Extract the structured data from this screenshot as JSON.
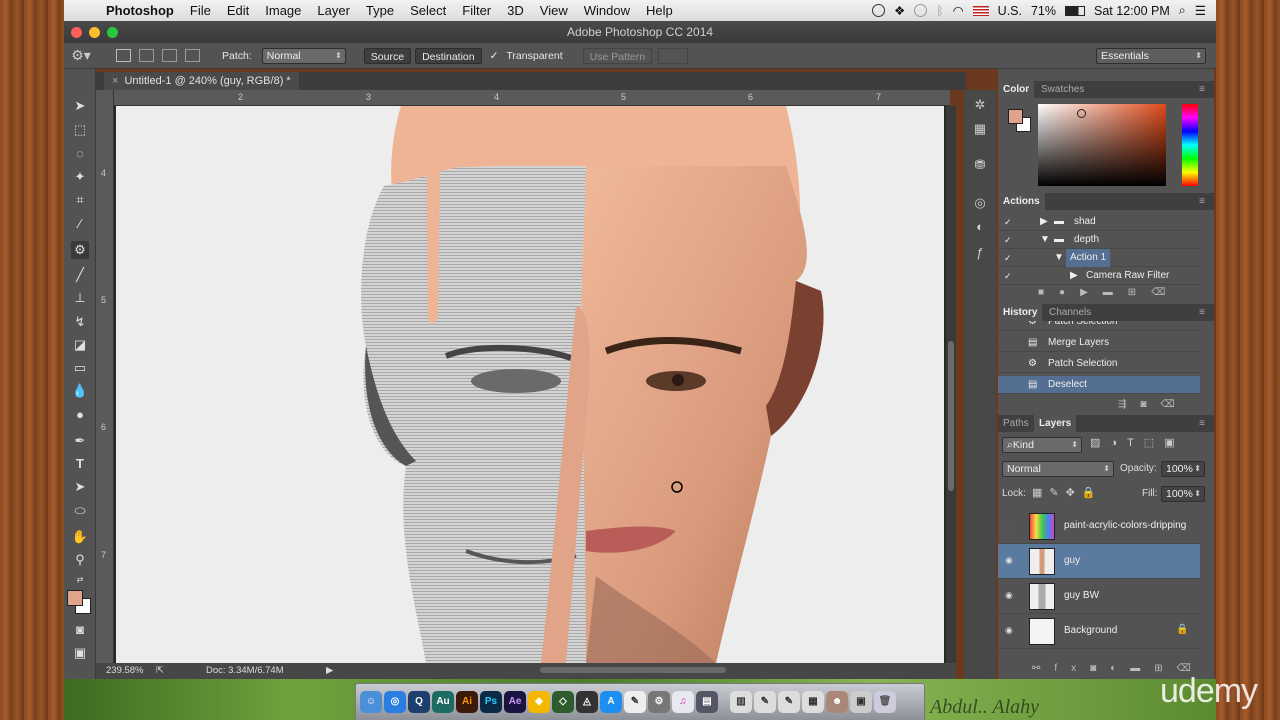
{
  "mac_menu": {
    "app": "Photoshop",
    "items": [
      "File",
      "Edit",
      "Image",
      "Layer",
      "Type",
      "Select",
      "Filter",
      "3D",
      "View",
      "Window",
      "Help"
    ],
    "status": {
      "input": "U.S.",
      "battery": "71%",
      "clock": "Sat 12:00 PM"
    }
  },
  "window": {
    "title": "Adobe Photoshop CC 2014"
  },
  "options_bar": {
    "patch_label": "Patch:",
    "patch_mode": "Normal",
    "source": "Source",
    "destination": "Destination",
    "transparent": "Transparent",
    "transparent_checked": true,
    "use_pattern": "Use Pattern",
    "workspace": "Essentials"
  },
  "document": {
    "tab": "Untitled-1 @ 240% (guy, RGB/8) *",
    "ruler_h": [
      "2",
      "3",
      "4",
      "5",
      "6",
      "7"
    ],
    "ruler_v": [
      "4",
      "5",
      "6",
      "7"
    ],
    "zoom": "239.58%",
    "doc_size": "Doc: 3.34M/6.74M"
  },
  "color_panel": {
    "tabs": [
      "Color",
      "Swatches"
    ],
    "foreground": "#e0a48c",
    "background": "#ffffff"
  },
  "actions_panel": {
    "title": "Actions",
    "rows": [
      {
        "label": "shad",
        "type": "set",
        "expanded": false
      },
      {
        "label": "depth",
        "type": "set",
        "expanded": true
      },
      {
        "label": "Action 1",
        "type": "action",
        "expanded": true,
        "selected": true
      },
      {
        "label": "Camera Raw Filter",
        "type": "step",
        "expanded": false
      }
    ]
  },
  "history_panel": {
    "tabs": [
      "History",
      "Channels"
    ],
    "items": [
      {
        "label": "Patch Selection",
        "icon": "patch-icon"
      },
      {
        "label": "Merge Layers",
        "icon": "doc-icon"
      },
      {
        "label": "Patch Selection",
        "icon": "patch-icon"
      },
      {
        "label": "Deselect",
        "icon": "doc-icon",
        "selected": true
      }
    ]
  },
  "layers_panel": {
    "tabs": [
      "Paths",
      "Layers"
    ],
    "filter": "Kind",
    "blend_mode": "Normal",
    "opacity_label": "Opacity:",
    "opacity": "100%",
    "lock_label": "Lock:",
    "fill_label": "Fill:",
    "fill": "100%",
    "layers": [
      {
        "name": "paint-acrylic-colors-dripping",
        "visible": false
      },
      {
        "name": "guy",
        "visible": true,
        "selected": true
      },
      {
        "name": "guy BW",
        "visible": true
      },
      {
        "name": "Background",
        "visible": true,
        "locked": true
      }
    ]
  },
  "dock": {
    "apps": [
      "Ai",
      "Ps",
      "Ae"
    ]
  },
  "watermark": {
    "brand": "udemy",
    "signature": "Abdul.. Alahy"
  }
}
